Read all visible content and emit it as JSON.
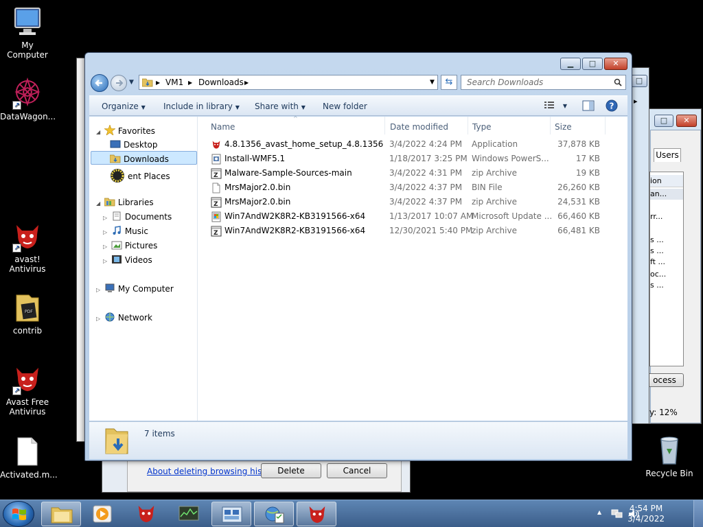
{
  "desktop": {
    "icons": [
      {
        "label": "My Computer"
      },
      {
        "label": "DataWagon..."
      },
      {
        "label": "avast! Antivirus"
      },
      {
        "label": "contrib"
      },
      {
        "label": "Avast Free Antivirus"
      },
      {
        "label": "Activated.m..."
      },
      {
        "label": "Recycle Bin"
      }
    ]
  },
  "background_windows": {
    "tab_label": "Users",
    "process_button": "ocess",
    "cpu_text": "y: 12%",
    "list_fragments": [
      "ion",
      "an...",
      "rr...",
      "s ...",
      "s ...",
      "ft ...",
      "oc...",
      "s ..."
    ],
    "dialog_link": "About deleting browsing history",
    "delete_button": "Delete",
    "cancel_button": "Cancel"
  },
  "explorer": {
    "breadcrumb": [
      "VM1",
      "Downloads"
    ],
    "search_placeholder": "Search Downloads",
    "toolbar": {
      "organize": "Organize",
      "include_in_library": "Include in library",
      "share_with": "Share with",
      "new_folder": "New folder"
    },
    "nav": {
      "favorites": "Favorites",
      "desktop": "Desktop",
      "downloads": "Downloads",
      "recent_places": "ent Places",
      "libraries": "Libraries",
      "documents": "Documents",
      "music": "Music",
      "pictures": "Pictures",
      "videos": "Videos",
      "my_computer": "My Computer",
      "network": "Network"
    },
    "columns": {
      "name": "Name",
      "date_modified": "Date modified",
      "type": "Type",
      "size": "Size"
    },
    "files": [
      {
        "name": "4.8.1356_avast_home_setup_4.8.1356",
        "date": "3/4/2022 4:24 PM",
        "type": "Application",
        "size": "37,878 KB",
        "icon": "avast-icon"
      },
      {
        "name": "Install-WMF5.1",
        "date": "1/18/2017 3:25 PM",
        "type": "Windows PowerS...",
        "size": "17 KB",
        "icon": "script-icon"
      },
      {
        "name": "Malware-Sample-Sources-main",
        "date": "3/4/2022 4:31 PM",
        "type": "zip Archive",
        "size": "19 KB",
        "icon": "zip-icon"
      },
      {
        "name": "MrsMajor2.0.bin",
        "date": "3/4/2022 4:37 PM",
        "type": "BIN File",
        "size": "26,260 KB",
        "icon": "file-icon"
      },
      {
        "name": "MrsMajor2.0.bin",
        "date": "3/4/2022 4:37 PM",
        "type": "zip Archive",
        "size": "24,531 KB",
        "icon": "zip-icon"
      },
      {
        "name": "Win7AndW2K8R2-KB3191566-x64",
        "date": "1/13/2017 10:07 AM",
        "type": "Microsoft Update ...",
        "size": "66,460 KB",
        "icon": "update-icon"
      },
      {
        "name": "Win7AndW2K8R2-KB3191566-x64",
        "date": "12/30/2021 5:40 PM",
        "type": "zip Archive",
        "size": "66,481 KB",
        "icon": "zip-icon"
      }
    ],
    "item_count": "7 items"
  },
  "taskbar": {
    "time": "4:54 PM",
    "date": "3/4/2022"
  },
  "colors": {
    "selection": "#cce8ff",
    "taskbar": "#4a6e9c",
    "avast_red": "#c8201c"
  }
}
